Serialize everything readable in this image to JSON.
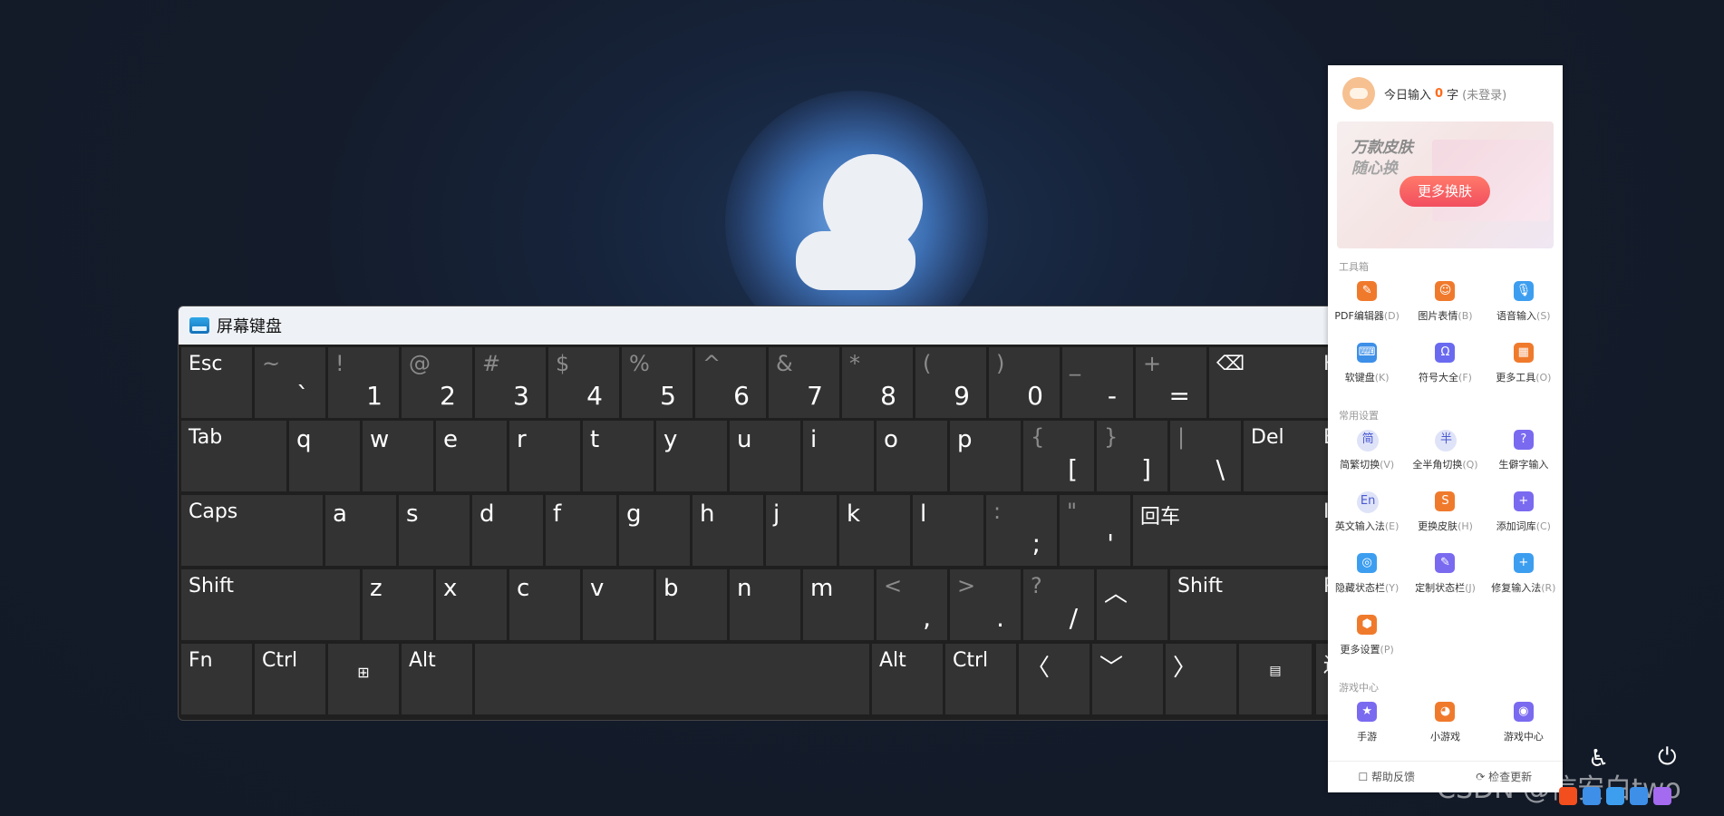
{
  "keyboard": {
    "title": "屏幕键盘",
    "keys": {
      "esc": "Esc",
      "tab": "Tab",
      "caps": "Caps",
      "shift": "Shift",
      "fn": "Fn",
      "ctrl": "Ctrl",
      "alt": "Alt",
      "del": "Del",
      "enter": "回车",
      "r_alt": "Alt",
      "r_ctrl": "Ctrl",
      "r_shift": "Shift"
    },
    "number_row": [
      {
        "top": "~",
        "bottom": "`"
      },
      {
        "top": "!",
        "bottom": "1"
      },
      {
        "top": "@",
        "bottom": "2"
      },
      {
        "top": "#",
        "bottom": "3"
      },
      {
        "top": "$",
        "bottom": "4"
      },
      {
        "top": "%",
        "bottom": "5"
      },
      {
        "top": "^",
        "bottom": "6"
      },
      {
        "top": "&",
        "bottom": "7"
      },
      {
        "top": "*",
        "bottom": "8"
      },
      {
        "top": "(",
        "bottom": "9"
      },
      {
        "top": ")",
        "bottom": "0"
      },
      {
        "top": "_",
        "bottom": "-"
      },
      {
        "top": "+",
        "bottom": "="
      }
    ],
    "row_q": [
      "q",
      "w",
      "e",
      "r",
      "t",
      "y",
      "u",
      "i",
      "o",
      "p"
    ],
    "row_q_sym": [
      {
        "top": "{",
        "bottom": "["
      },
      {
        "top": "}",
        "bottom": "]"
      },
      {
        "top": "|",
        "bottom": "\\"
      }
    ],
    "row_a": [
      "a",
      "s",
      "d",
      "f",
      "g",
      "h",
      "j",
      "k",
      "l"
    ],
    "row_a_sym": [
      {
        "top": ":",
        "bottom": ";"
      },
      {
        "top": "\"",
        "bottom": "'"
      }
    ],
    "row_z": [
      "z",
      "x",
      "c",
      "v",
      "b",
      "n",
      "m"
    ],
    "row_z_sym": [
      {
        "top": "<",
        "bottom": ","
      },
      {
        "top": ">",
        "bottom": "."
      },
      {
        "top": "?",
        "bottom": "/"
      }
    ],
    "cut_labels": [
      "H",
      "E",
      "In",
      "P",
      "迸"
    ]
  },
  "panel": {
    "today_label": "今日输入",
    "count": "0",
    "unit": "字",
    "login_state": "(未登录)",
    "banner_line1": "万款皮肤",
    "banner_line2": "随心换",
    "banner_button": "更多换肤",
    "sections": [
      {
        "title": "工具箱",
        "tools": [
          {
            "label": "PDF编辑器",
            "hotkey": "(D)",
            "icon": "pdf-icon",
            "color": "#f07a2c",
            "glyph": "✎"
          },
          {
            "label": "图片表情",
            "hotkey": "(B)",
            "icon": "emoji-icon",
            "color": "#f07a2c",
            "glyph": "☺"
          },
          {
            "label": "语音输入",
            "hotkey": "(S)",
            "icon": "microphone-icon",
            "color": "#3d9ef0",
            "glyph": "🎙"
          },
          {
            "label": "软键盘",
            "hotkey": "(K)",
            "icon": "keyboard-icon",
            "color": "#3d8fe8",
            "glyph": "⌨"
          },
          {
            "label": "符号大全",
            "hotkey": "(F)",
            "icon": "symbol-icon",
            "color": "#6a6af0",
            "glyph": "Ω"
          },
          {
            "label": "更多工具",
            "hotkey": "(O)",
            "icon": "more-tools-icon",
            "color": "#f07a2c",
            "glyph": "▦"
          }
        ]
      },
      {
        "title": "常用设置",
        "tools": [
          {
            "label": "简繁切换",
            "hotkey": "(V)",
            "icon": "simplified-traditional-icon",
            "color": "#dfe3f8",
            "glyph": "简"
          },
          {
            "label": "全半角切换",
            "hotkey": "(Q)",
            "icon": "full-half-width-icon",
            "color": "#dfe3f8",
            "glyph": "半"
          },
          {
            "label": "生僻字输入",
            "hotkey": "",
            "icon": "rare-char-icon",
            "color": "#7a6af0",
            "glyph": "?"
          },
          {
            "label": "英文输入法",
            "hotkey": "(E)",
            "icon": "english-input-icon",
            "color": "#dfe3f8",
            "glyph": "En"
          },
          {
            "label": "更换皮肤",
            "hotkey": "(H)",
            "icon": "skin-icon",
            "color": "#f07a2c",
            "glyph": "S"
          },
          {
            "label": "添加词库",
            "hotkey": "(C)",
            "icon": "dictionary-icon",
            "color": "#7a6af0",
            "glyph": "+"
          },
          {
            "label": "隐藏状态栏",
            "hotkey": "(Y)",
            "icon": "hide-statusbar-icon",
            "color": "#3d9ef0",
            "glyph": "◎"
          },
          {
            "label": "定制状态栏",
            "hotkey": "(J)",
            "icon": "customize-statusbar-icon",
            "color": "#7a6af0",
            "glyph": "✎"
          },
          {
            "label": "修复输入法",
            "hotkey": "(R)",
            "icon": "repair-icon",
            "color": "#3d9ef0",
            "glyph": "+"
          },
          {
            "label": "更多设置",
            "hotkey": "(P)",
            "icon": "more-settings-icon",
            "color": "#f07a2c",
            "glyph": "⬢"
          }
        ]
      },
      {
        "title": "游戏中心",
        "tools": [
          {
            "label": "手游",
            "hotkey": "",
            "icon": "mobile-game-icon",
            "color": "#7a6af0",
            "glyph": "★"
          },
          {
            "label": "小游戏",
            "hotkey": "",
            "icon": "mini-game-icon",
            "color": "#f07a2c",
            "glyph": "◕"
          },
          {
            "label": "游戏中心",
            "hotkey": "",
            "icon": "game-center-icon",
            "color": "#7a6af0",
            "glyph": "◉"
          }
        ]
      }
    ],
    "footer": {
      "help": "帮助反馈",
      "update": "检查更新"
    }
  },
  "watermark": "CSDN @信安白two"
}
